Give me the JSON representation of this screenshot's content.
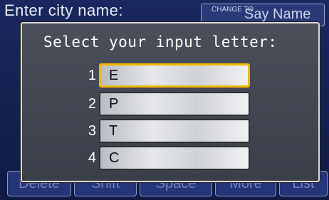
{
  "background": {
    "title": "Enter city name:",
    "change_label": "CHANGE TO",
    "say_name_label": "Say Name",
    "keys": [
      {
        "label": "Delete"
      },
      {
        "label": "Shift"
      },
      {
        "label": "Space"
      },
      {
        "label": "More"
      },
      {
        "label": "List"
      }
    ]
  },
  "dialog": {
    "title": "Select your input letter:",
    "options": [
      {
        "number": "1",
        "letter": "E",
        "selected": true
      },
      {
        "number": "2",
        "letter": "P",
        "selected": false
      },
      {
        "number": "3",
        "letter": "T",
        "selected": false
      },
      {
        "number": "4",
        "letter": "C",
        "selected": false
      }
    ]
  },
  "colors": {
    "background": "#152150",
    "highlight": "#f2b800"
  }
}
